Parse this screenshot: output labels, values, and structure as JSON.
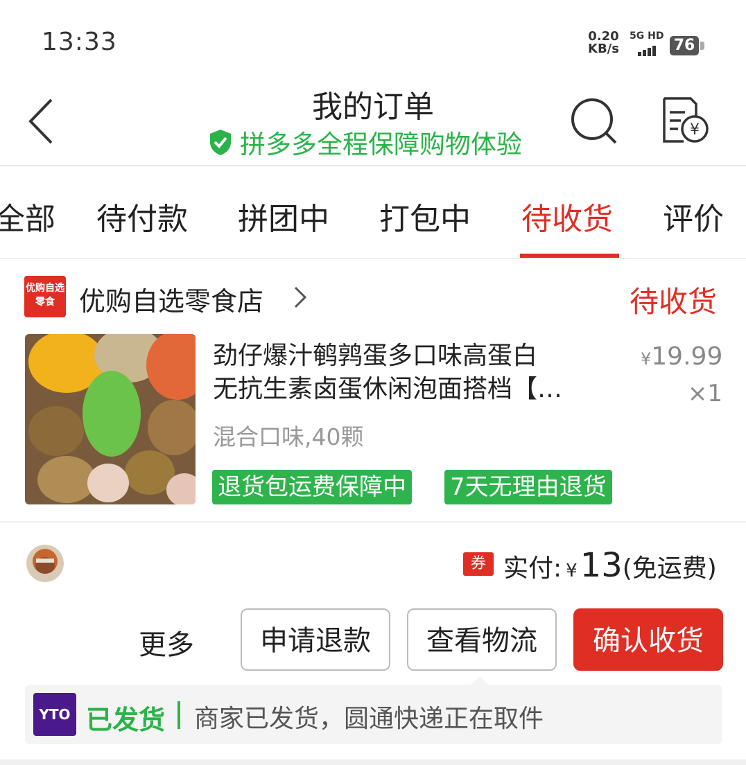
{
  "status_bar": {
    "time": "13:33",
    "net_speed": "0.20",
    "net_unit": "KB/s",
    "signal_label": "5G HD",
    "battery": "76"
  },
  "header": {
    "title": "我的订单",
    "subtitle": "拼多多全程保障购物体验",
    "icons": [
      "back-icon",
      "search-icon",
      "bill-icon",
      "shield-check-icon"
    ]
  },
  "tabs": [
    {
      "label": "全部",
      "active": false
    },
    {
      "label": "待付款",
      "active": false
    },
    {
      "label": "拼团中",
      "active": false
    },
    {
      "label": "打包中",
      "active": false
    },
    {
      "label": "待收货",
      "active": true
    },
    {
      "label": "评价",
      "active": false
    }
  ],
  "order": {
    "store": {
      "logo_text_1": "优购自选",
      "logo_text_2": "零食",
      "name": "优购自选零食店",
      "status": "待收货"
    },
    "product": {
      "title_line1": "劲仔爆汁鹌鹑蛋多口味高蛋白",
      "title_line2": "无抗生素卤蛋休闲泡面搭档【…",
      "price_symbol": "¥",
      "price_main": "19.",
      "price_decimal": "99",
      "quantity": "×1",
      "spec": "混合口味,40颗",
      "tags": [
        "退货包运费保障中",
        "7天无理由退货"
      ]
    },
    "payment": {
      "coupon_label": "券",
      "paid_label": "实付:",
      "currency": "¥",
      "amount": "13",
      "shipping_note": "(免运费)"
    },
    "actions": {
      "more": "更多",
      "refund": "申请退款",
      "logistics": "查看物流",
      "confirm": "确认收货"
    },
    "logistics": {
      "carrier_logo": "YTO",
      "status": "已发货",
      "message": "商家已发货，圆通快递正在取件"
    }
  },
  "colors": {
    "accent": "#e02e24",
    "green": "#2bb34a",
    "tag_green": "#2fb34d"
  }
}
